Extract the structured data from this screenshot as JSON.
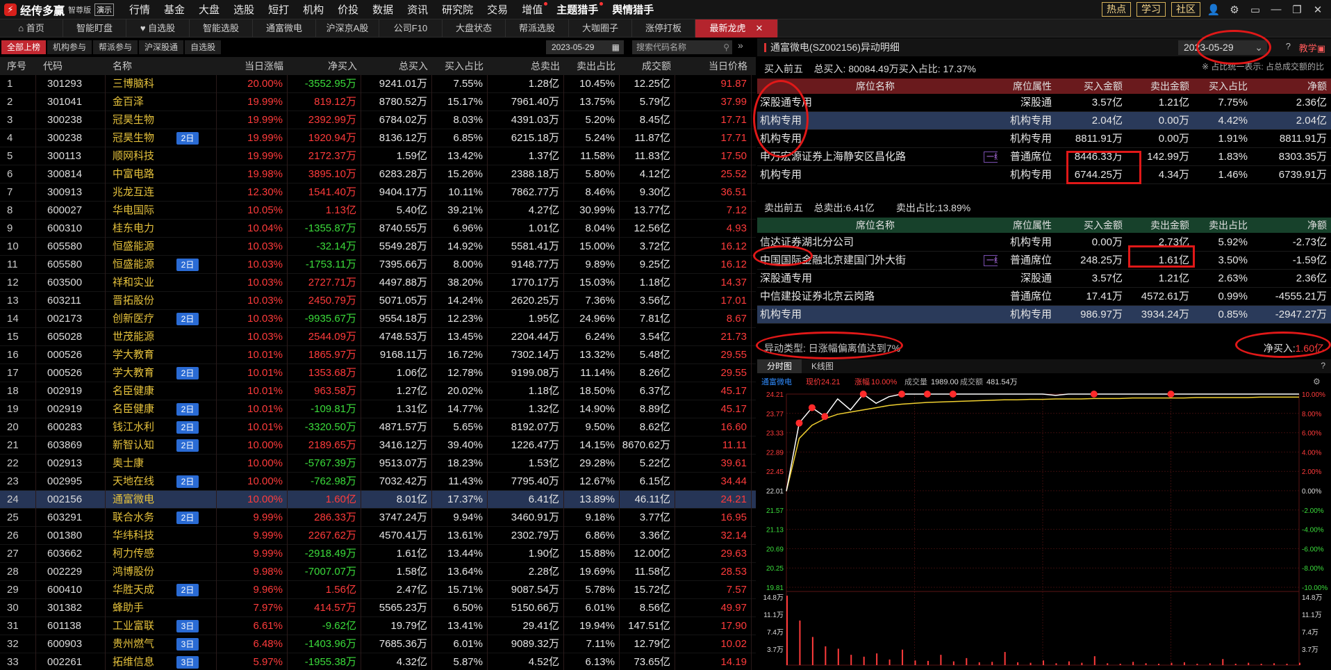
{
  "app": {
    "name": "经传多赢",
    "edition": "智尊版",
    "demo": "演示",
    "menu": [
      "行情",
      "基金",
      "大盘",
      "选股",
      "短打",
      "机构",
      "价投",
      "数据",
      "资讯",
      "研究院",
      "交易",
      "增值",
      "主题猎手",
      "舆情猎手"
    ],
    "right_buttons": [
      "热点",
      "学习",
      "社区"
    ],
    "right_icons": [
      "user-icon",
      "gear-icon",
      "window-icon",
      "minimize-icon",
      "restore-icon",
      "close-icon"
    ]
  },
  "tabs": [
    "首页",
    "智能盯盘",
    "自选股",
    "智能选股",
    "通富微电",
    "沪深京A股",
    "公司F10",
    "大盘状态",
    "帮派选股",
    "大咖圈子",
    "涨停打板",
    "最新龙虎"
  ],
  "active_tab": "最新龙虎",
  "sub_tabs": [
    "全部上榜",
    "机构参与",
    "帮派参与",
    "沪深股通",
    "自选股"
  ],
  "date": "2023-05-29",
  "search_placeholder": "搜索代码名称",
  "zoom": "105%",
  "left_columns": [
    "序号",
    "代码",
    "名称",
    "当日涨幅",
    "净买入",
    "总买入",
    "买入占比",
    "总卖出",
    "卖出占比",
    "成交额",
    "当日价格"
  ],
  "rows": [
    [
      "1",
      "301293",
      "三博脑科",
      "",
      "20.00%",
      "-3552.95万",
      "9241.01万",
      "7.55%",
      "1.28亿",
      "10.45%",
      "12.25亿",
      "91.87"
    ],
    [
      "2",
      "301041",
      "金百泽",
      "",
      "19.99%",
      "819.12万",
      "8780.52万",
      "15.17%",
      "7961.40万",
      "13.75%",
      "5.79亿",
      "37.99"
    ],
    [
      "3",
      "300238",
      "冠昊生物",
      "",
      "19.99%",
      "2392.99万",
      "6784.02万",
      "8.03%",
      "4391.03万",
      "5.20%",
      "8.45亿",
      "17.71"
    ],
    [
      "4",
      "300238",
      "冠昊生物",
      "2日",
      "19.99%",
      "1920.94万",
      "8136.12万",
      "6.85%",
      "6215.18万",
      "5.24%",
      "11.87亿",
      "17.71"
    ],
    [
      "5",
      "300113",
      "顺网科技",
      "",
      "19.99%",
      "2172.37万",
      "1.59亿",
      "13.42%",
      "1.37亿",
      "11.58%",
      "11.83亿",
      "17.50"
    ],
    [
      "6",
      "300814",
      "中富电路",
      "",
      "19.98%",
      "3895.10万",
      "6283.28万",
      "15.26%",
      "2388.18万",
      "5.80%",
      "4.12亿",
      "25.52"
    ],
    [
      "7",
      "300913",
      "兆龙互连",
      "",
      "12.30%",
      "1541.40万",
      "9404.17万",
      "10.11%",
      "7862.77万",
      "8.46%",
      "9.30亿",
      "36.51"
    ],
    [
      "8",
      "600027",
      "华电国际",
      "",
      "10.05%",
      "1.13亿",
      "5.40亿",
      "39.21%",
      "4.27亿",
      "30.99%",
      "13.77亿",
      "7.12"
    ],
    [
      "9",
      "600310",
      "桂东电力",
      "",
      "10.04%",
      "-1355.87万",
      "8740.55万",
      "6.96%",
      "1.01亿",
      "8.04%",
      "12.56亿",
      "4.93"
    ],
    [
      "10",
      "605580",
      "恒盛能源",
      "",
      "10.03%",
      "-32.14万",
      "5549.28万",
      "14.92%",
      "5581.41万",
      "15.00%",
      "3.72亿",
      "16.12"
    ],
    [
      "11",
      "605580",
      "恒盛能源",
      "2日",
      "10.03%",
      "-1753.11万",
      "7395.66万",
      "8.00%",
      "9148.77万",
      "9.89%",
      "9.25亿",
      "16.12"
    ],
    [
      "12",
      "603500",
      "祥和实业",
      "",
      "10.03%",
      "2727.71万",
      "4497.88万",
      "38.20%",
      "1770.17万",
      "15.03%",
      "1.18亿",
      "14.37"
    ],
    [
      "13",
      "603211",
      "晋拓股份",
      "",
      "10.03%",
      "2450.79万",
      "5071.05万",
      "14.24%",
      "2620.25万",
      "7.36%",
      "3.56亿",
      "17.01"
    ],
    [
      "14",
      "002173",
      "创新医疗",
      "2日",
      "10.03%",
      "-9935.67万",
      "9554.18万",
      "12.23%",
      "1.95亿",
      "24.96%",
      "7.81亿",
      "8.67"
    ],
    [
      "15",
      "605028",
      "世茂能源",
      "",
      "10.03%",
      "2544.09万",
      "4748.53万",
      "13.45%",
      "2204.44万",
      "6.24%",
      "3.54亿",
      "21.73"
    ],
    [
      "16",
      "000526",
      "学大教育",
      "",
      "10.01%",
      "1865.97万",
      "9168.11万",
      "16.72%",
      "7302.14万",
      "13.32%",
      "5.48亿",
      "29.55"
    ],
    [
      "17",
      "000526",
      "学大教育",
      "2日",
      "10.01%",
      "1353.68万",
      "1.06亿",
      "12.78%",
      "9199.08万",
      "11.14%",
      "8.26亿",
      "29.55"
    ],
    [
      "18",
      "002919",
      "名臣健康",
      "",
      "10.01%",
      "963.58万",
      "1.27亿",
      "20.02%",
      "1.18亿",
      "18.50%",
      "6.37亿",
      "45.17"
    ],
    [
      "19",
      "002919",
      "名臣健康",
      "2日",
      "10.01%",
      "-109.81万",
      "1.31亿",
      "14.77%",
      "1.32亿",
      "14.90%",
      "8.89亿",
      "45.17"
    ],
    [
      "20",
      "600283",
      "钱江水利",
      "2日",
      "10.01%",
      "-3320.50万",
      "4871.57万",
      "5.65%",
      "8192.07万",
      "9.50%",
      "8.62亿",
      "16.60"
    ],
    [
      "21",
      "603869",
      "新智认知",
      "2日",
      "10.00%",
      "2189.65万",
      "3416.12万",
      "39.40%",
      "1226.47万",
      "14.15%",
      "8670.62万",
      "11.11"
    ],
    [
      "22",
      "002913",
      "奥士康",
      "",
      "10.00%",
      "-5767.39万",
      "9513.07万",
      "18.23%",
      "1.53亿",
      "29.28%",
      "5.22亿",
      "39.61"
    ],
    [
      "23",
      "002995",
      "天地在线",
      "2日",
      "10.00%",
      "-762.98万",
      "7032.42万",
      "11.43%",
      "7795.40万",
      "12.67%",
      "6.15亿",
      "34.44"
    ],
    [
      "24",
      "002156",
      "通富微电",
      "",
      "10.00%",
      "1.60亿",
      "8.01亿",
      "17.37%",
      "6.41亿",
      "13.89%",
      "46.11亿",
      "24.21"
    ],
    [
      "25",
      "603291",
      "联合水务",
      "2日",
      "9.99%",
      "286.33万",
      "3747.24万",
      "9.94%",
      "3460.91万",
      "9.18%",
      "3.77亿",
      "16.95"
    ],
    [
      "26",
      "001380",
      "华纬科技",
      "",
      "9.99%",
      "2267.62万",
      "4570.41万",
      "13.61%",
      "2302.79万",
      "6.86%",
      "3.36亿",
      "32.14"
    ],
    [
      "27",
      "603662",
      "柯力传感",
      "",
      "9.99%",
      "-2918.49万",
      "1.61亿",
      "13.44%",
      "1.90亿",
      "15.88%",
      "12.00亿",
      "29.63"
    ],
    [
      "28",
      "002229",
      "鸿博股份",
      "",
      "9.98%",
      "-7007.07万",
      "1.58亿",
      "13.64%",
      "2.28亿",
      "19.69%",
      "11.58亿",
      "28.53"
    ],
    [
      "29",
      "600410",
      "华胜天成",
      "2日",
      "9.96%",
      "1.56亿",
      "2.47亿",
      "15.71%",
      "9087.54万",
      "5.78%",
      "15.72亿",
      "7.57"
    ],
    [
      "30",
      "301382",
      "蜂助手",
      "",
      "7.97%",
      "414.57万",
      "5565.23万",
      "6.50%",
      "5150.66万",
      "6.01%",
      "8.56亿",
      "49.97"
    ],
    [
      "31",
      "601138",
      "工业富联",
      "3日",
      "6.61%",
      "-9.62亿",
      "19.79亿",
      "13.41%",
      "29.41亿",
      "19.94%",
      "147.51亿",
      "17.90"
    ],
    [
      "32",
      "600903",
      "贵州燃气",
      "3日",
      "6.48%",
      "-1403.96万",
      "7685.36万",
      "6.01%",
      "9089.32万",
      "7.11%",
      "12.79亿",
      "10.02"
    ],
    [
      "33",
      "002261",
      "拓维信息",
      "3日",
      "5.97%",
      "-1955.38万",
      "4.32亿",
      "5.87%",
      "4.52亿",
      "6.13%",
      "73.65亿",
      "14.19"
    ]
  ],
  "detail": {
    "title": "通富微电(SZ002156)异动明细",
    "date": "2023-05-29",
    "teach": "教学",
    "buy_summary_label": "买入前五",
    "buy_summary": "总买入: 80084.49万买入占比: 17.37%",
    "note": "※ 占比统一表示: 占总成交额的比",
    "columns": [
      "席位名称",
      "席位属性",
      "买入金额",
      "卖出金额",
      "买入占比",
      "净额"
    ],
    "sell_columns": [
      "席位名称",
      "席位属性",
      "买入金额",
      "卖出金额",
      "卖出占比",
      "净额"
    ],
    "buy_rows": [
      [
        "深股通专用",
        "",
        "深股通",
        "3.57亿",
        "1.21亿",
        "7.75%",
        "2.36亿"
      ],
      [
        "机构专用",
        "",
        "机构专用",
        "2.04亿",
        "0.00万",
        "4.42%",
        "2.04亿"
      ],
      [
        "机构专用",
        "",
        "机构专用",
        "8811.91万",
        "0.00万",
        "1.91%",
        "8811.91万"
      ],
      [
        "申万宏源证券上海静安区昌化路",
        "一线",
        "普通席位",
        "8446.33万",
        "142.99万",
        "1.83%",
        "8303.35万"
      ],
      [
        "机构专用",
        "",
        "机构专用",
        "6744.25万",
        "4.34万",
        "1.46%",
        "6739.91万"
      ]
    ],
    "sell_summary_label": "卖出前五",
    "sell_total": "总卖出:6.41亿",
    "sell_ratio": "卖出占比:13.89%",
    "sell_rows": [
      [
        "信达证券湖北分公司",
        "",
        "机构专用",
        "0.00万",
        "2.73亿",
        "5.92%",
        "-2.73亿"
      ],
      [
        "中国国际金融北京建国门外大街",
        "一线",
        "普通席位",
        "248.25万",
        "1.61亿",
        "3.50%",
        "-1.59亿"
      ],
      [
        "深股通专用",
        "",
        "深股通",
        "3.57亿",
        "1.21亿",
        "2.63%",
        "2.36亿"
      ],
      [
        "中信建投证券北京云岗路",
        "",
        "普通席位",
        "17.41万",
        "4572.61万",
        "0.99%",
        "-4555.21万"
      ],
      [
        "机构专用",
        "",
        "机构专用",
        "986.97万",
        "3934.24万",
        "0.85%",
        "-2947.27万"
      ]
    ],
    "anomaly": "异动类型: 日涨幅偏离值达到7%",
    "net_buy_label": "净买入:",
    "net_buy_value": "1.60亿",
    "chart_tabs": [
      "分时图",
      "K线图"
    ]
  },
  "chart_data": {
    "type": "line",
    "name": "通富微电",
    "price_label": "现价",
    "price": "24.21",
    "pct_label": "涨幅",
    "pct": "10.00%",
    "vol_label": "成交量",
    "vol": "1989.00",
    "amt_label": "成交额",
    "amt": "481.54万",
    "y_price_ticks": [
      "24.21",
      "23.77",
      "23.33",
      "22.89",
      "22.45",
      "22.01",
      "21.57",
      "21.13",
      "20.69",
      "20.25",
      "19.81"
    ],
    "y_pct_ticks": [
      "10.00%",
      "8.00%",
      "6.00%",
      "4.00%",
      "2.00%",
      "0.00%",
      "-2.00%",
      "-4.00%",
      "-6.00%",
      "-8.00%",
      "-10.00%"
    ],
    "vol_ticks": [
      "14.8万",
      "11.1万",
      "7.4万",
      "3.7万"
    ],
    "ylim": [
      19.81,
      24.21
    ],
    "price_series": [
      22.0,
      23.55,
      23.9,
      23.7,
      24.1,
      23.85,
      24.21,
      24.0,
      24.15,
      24.21,
      24.21,
      24.21,
      24.21,
      24.21,
      24.21,
      24.21,
      24.21,
      24.21,
      24.21,
      24.21,
      24.21,
      24.18,
      24.21,
      24.21,
      24.21,
      24.21,
      24.21,
      24.21,
      24.21,
      24.21,
      24.21,
      24.21,
      24.21,
      24.21,
      24.21,
      24.21,
      24.21,
      24.21,
      24.21,
      24.21,
      24.21
    ],
    "avg_series": [
      22.0,
      23.2,
      23.5,
      23.65,
      23.75,
      23.8,
      23.85,
      23.9,
      23.95,
      23.98,
      24.0,
      24.02,
      24.03,
      24.04,
      24.05,
      24.06,
      24.07,
      24.08,
      24.08,
      24.09,
      24.09,
      24.1,
      24.1,
      24.1,
      24.11,
      24.11,
      24.11,
      24.12,
      24.12,
      24.12,
      24.12,
      24.12,
      24.13,
      24.13,
      24.13,
      24.13,
      24.13,
      24.14,
      24.14,
      24.14,
      24.14
    ],
    "markers": [
      1,
      2,
      3,
      6,
      9,
      11,
      13,
      24,
      30
    ],
    "volume": [
      14.8,
      9.5,
      6.0,
      4.0,
      3.5,
      2.2,
      1.8,
      2.5,
      1.2,
      3.3,
      1.0,
      0.9,
      2.2,
      0.8,
      1.5,
      0.6,
      0.7,
      2.8,
      0.6,
      0.5,
      1.0,
      0.4,
      0.8,
      0.5,
      1.9,
      0.4,
      0.3,
      0.7,
      0.4,
      0.3,
      0.5,
      0.6,
      0.3,
      0.4,
      1.3,
      0.3,
      0.5,
      0.3,
      0.4,
      0.3,
      0.5
    ]
  }
}
